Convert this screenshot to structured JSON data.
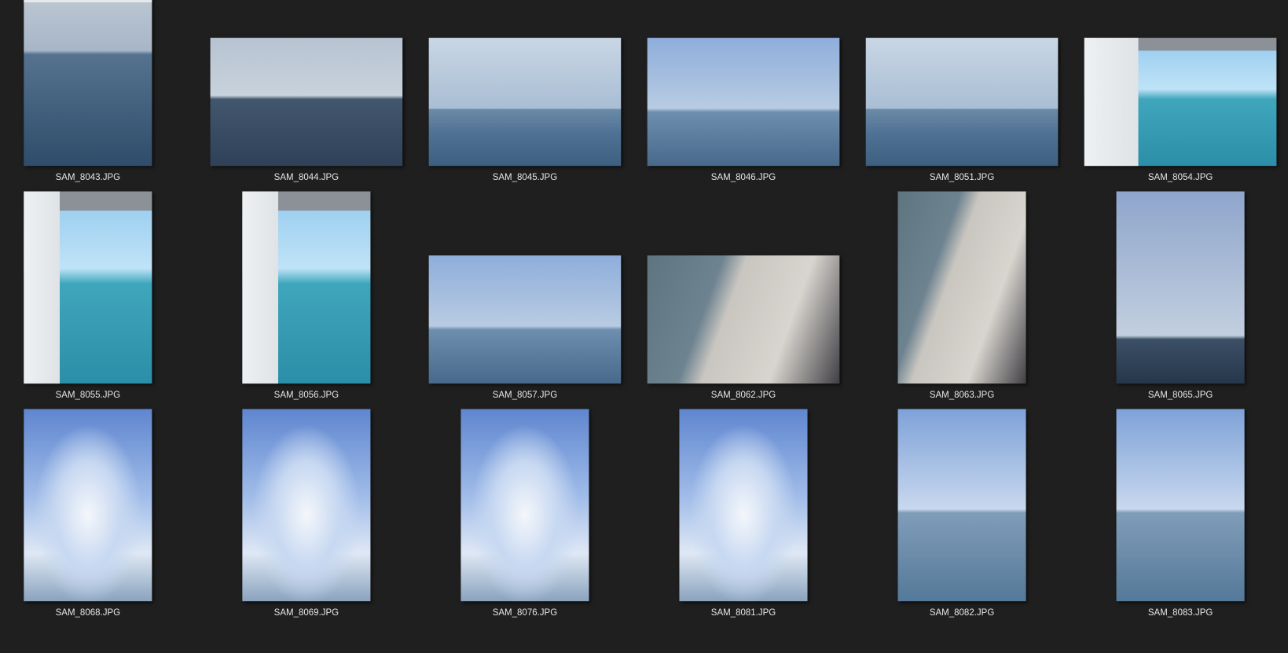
{
  "files": [
    {
      "name": "SAM_8043.JPG",
      "orientation": "portrait"
    },
    {
      "name": "SAM_8044.JPG",
      "orientation": "landscape"
    },
    {
      "name": "SAM_8045.JPG",
      "orientation": "landscape"
    },
    {
      "name": "SAM_8046.JPG",
      "orientation": "landscape"
    },
    {
      "name": "SAM_8051.JPG",
      "orientation": "landscape"
    },
    {
      "name": "SAM_8054.JPG",
      "orientation": "landscape"
    },
    {
      "name": "SAM_8055.JPG",
      "orientation": "portrait"
    },
    {
      "name": "SAM_8056.JPG",
      "orientation": "portrait"
    },
    {
      "name": "SAM_8057.JPG",
      "orientation": "landscape"
    },
    {
      "name": "SAM_8062.JPG",
      "orientation": "landscape"
    },
    {
      "name": "SAM_8063.JPG",
      "orientation": "portrait"
    },
    {
      "name": "SAM_8065.JPG",
      "orientation": "portrait"
    },
    {
      "name": "SAM_8068.JPG",
      "orientation": "portrait"
    },
    {
      "name": "SAM_8069.JPG",
      "orientation": "portrait"
    },
    {
      "name": "SAM_8076.JPG",
      "orientation": "portrait"
    },
    {
      "name": "SAM_8081.JPG",
      "orientation": "portrait"
    },
    {
      "name": "SAM_8082.JPG",
      "orientation": "portrait"
    },
    {
      "name": "SAM_8083.JPG",
      "orientation": "portrait"
    }
  ]
}
